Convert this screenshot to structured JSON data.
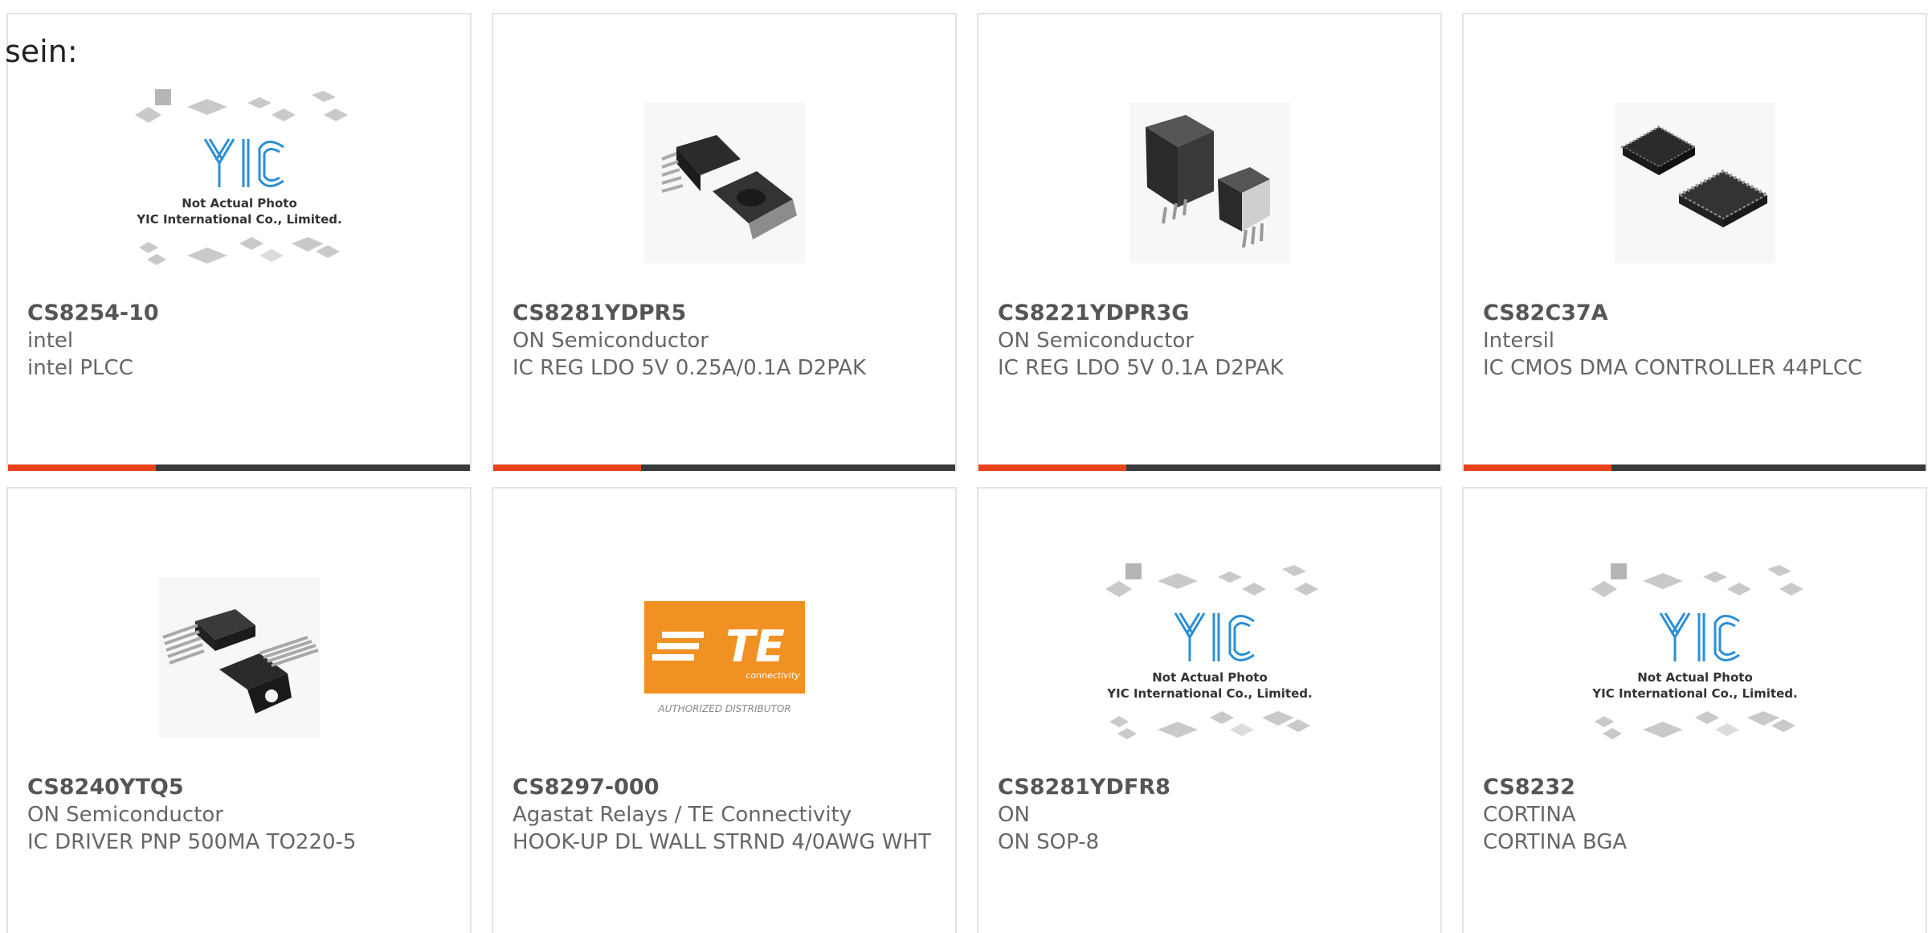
{
  "header": {
    "label": "sein:"
  },
  "placeholder_image": {
    "line1": "Not Actual Photo",
    "line2": "YIC International Co., Limited."
  },
  "te_logo": {
    "sub": "connectivity",
    "caption": "AUTHORIZED DISTRIBUTOR"
  },
  "colors": {
    "accent": "#e8431c",
    "bar": "#3a3a3a",
    "te_orange": "#f29123",
    "yic_blue": "#2a8fd6"
  },
  "products": [
    {
      "part": "CS8254-10",
      "manufacturer": "intel",
      "description": "intel PLCC",
      "image": "yic-placeholder-icon"
    },
    {
      "part": "CS8281YDPR5",
      "manufacturer": "ON Semiconductor",
      "description": "IC REG LDO 5V 0.25A/0.1A D2PAK",
      "image": "d2pak-icon"
    },
    {
      "part": "CS8221YDPR3G",
      "manufacturer": "ON Semiconductor",
      "description": "IC REG LDO 5V 0.1A D2PAK",
      "image": "d2pak-3lead-icon"
    },
    {
      "part": "CS82C37A",
      "manufacturer": "Intersil",
      "description": "IC CMOS DMA CONTROLLER 44PLCC",
      "image": "plcc-chip-icon"
    },
    {
      "part": "CS8240YTQ5",
      "manufacturer": "ON Semiconductor",
      "description": "IC DRIVER PNP 500MA TO220-5",
      "image": "to220-icon"
    },
    {
      "part": "CS8297-000",
      "manufacturer": "Agastat Relays / TE Connectivity",
      "description": "HOOK-UP DL WALL STRND 4/0AWG WHT",
      "image": "te-logo-icon"
    },
    {
      "part": "CS8281YDFR8",
      "manufacturer": "ON",
      "description": "ON SOP-8",
      "image": "yic-placeholder-icon"
    },
    {
      "part": "CS8232",
      "manufacturer": "CORTINA",
      "description": "CORTINA BGA",
      "image": "yic-placeholder-icon"
    }
  ]
}
